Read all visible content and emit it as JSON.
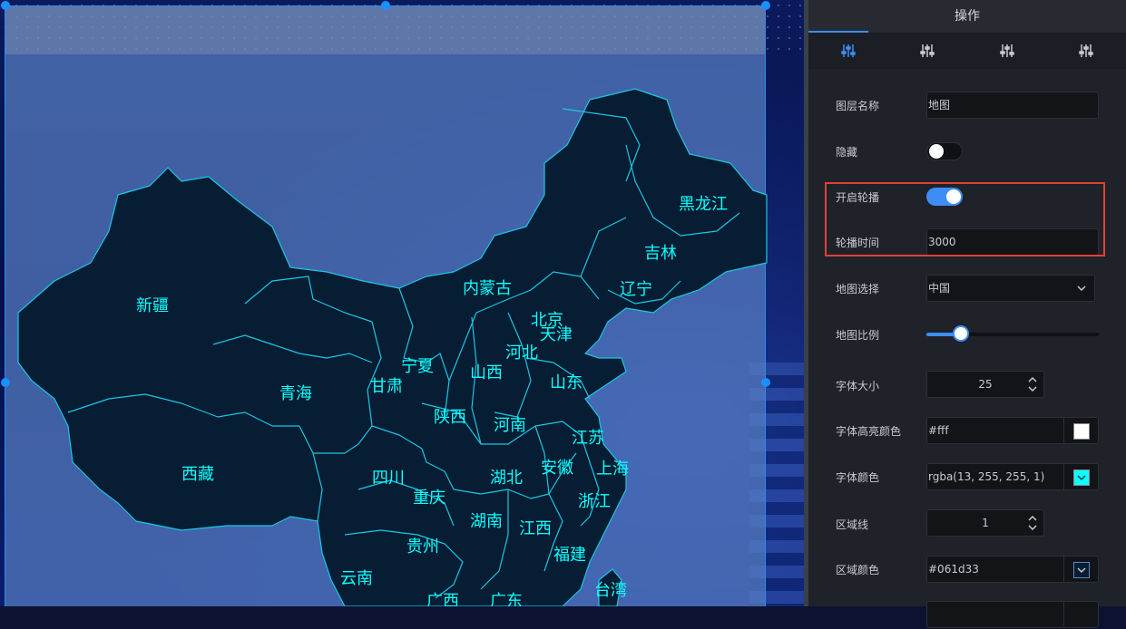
{
  "panel": {
    "title": "操作",
    "tabs": [
      {
        "icon": "sliders-icon",
        "active": true
      },
      {
        "icon": "sliders-icon",
        "active": false
      },
      {
        "icon": "sliders-icon",
        "active": false
      },
      {
        "icon": "sliders-icon",
        "active": false
      }
    ],
    "fields": {
      "layer_name": {
        "label": "图层名称",
        "value": "地图"
      },
      "hide": {
        "label": "隐藏",
        "on": false
      },
      "carousel": {
        "label": "开启轮播",
        "on": true
      },
      "carousel_time": {
        "label": "轮播时间",
        "value": "3000"
      },
      "map_select": {
        "label": "地图选择",
        "value": "中国"
      },
      "map_scale": {
        "label": "地图比例",
        "fraction": 0.2
      },
      "font_size": {
        "label": "字体大小",
        "value": "25"
      },
      "font_highlight_color": {
        "label": "字体高亮颜色",
        "value": "#fff",
        "swatch": "#ffffff"
      },
      "font_color": {
        "label": "字体颜色",
        "value": "rgba(13, 255, 255, 1)",
        "swatch": "#0dffff"
      },
      "border_line": {
        "label": "区域线",
        "value": "1"
      },
      "area_color": {
        "label": "区域颜色",
        "value": "#061d33",
        "swatch": "#061d33"
      }
    }
  },
  "map": {
    "fill": "#061d33",
    "stroke": "#19c7e6",
    "label_color": "#0dffff",
    "provinces": [
      "新疆",
      "西藏",
      "青海",
      "甘肃",
      "宁夏",
      "内蒙古",
      "黑龙江",
      "吉林",
      "辽宁",
      "北京",
      "天津",
      "河北",
      "山西",
      "山东",
      "陕西",
      "河南",
      "四川",
      "重庆",
      "湖北",
      "安徽",
      "江苏",
      "上海",
      "浙江",
      "湖南",
      "江西",
      "贵州",
      "云南",
      "福建",
      "广西",
      "广东",
      "台湾"
    ]
  },
  "colors": {
    "accent": "#3e8df7",
    "highlight_box": "#e0403a",
    "selection": "#1890ff"
  }
}
